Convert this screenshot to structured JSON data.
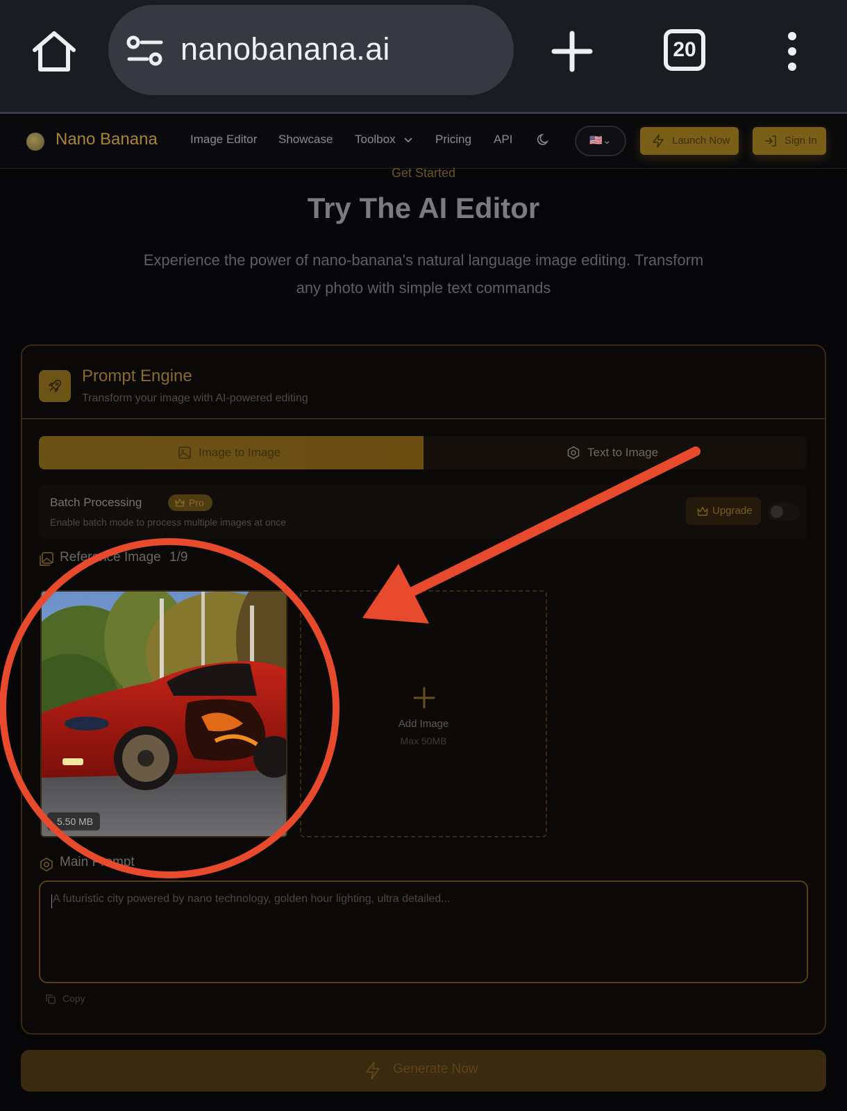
{
  "browser": {
    "url": "nanobanana.ai",
    "tab_count": "20"
  },
  "nav": {
    "brand": "Nano Banana",
    "links": [
      "Image Editor",
      "Showcase",
      "Toolbox",
      "Pricing",
      "API"
    ],
    "language_flag": "🇺🇸",
    "launch_label": "Launch Now",
    "signin_label": "Sign In"
  },
  "hero": {
    "eyebrow": "Get Started",
    "title": "Try The AI Editor",
    "subtitle": "Experience the power of nano-banana's natural language image editing. Transform any photo with simple text commands"
  },
  "card": {
    "title": "Prompt Engine",
    "subtitle": "Transform your image with AI-powered editing",
    "tabs": [
      {
        "label": "Image to Image",
        "active": true
      },
      {
        "label": "Text to Image",
        "active": false
      }
    ],
    "batch": {
      "title": "Batch Processing",
      "badge": "Pro",
      "description": "Enable batch mode to process multiple images at once",
      "upgrade_label": "Upgrade",
      "enabled": false
    },
    "reference": {
      "label": "Reference Image",
      "count": "1/9",
      "thumbnail_size": "5.50 MB",
      "add_label": "Add Image",
      "add_max": "Max 50MB"
    },
    "prompt": {
      "label": "Main Prompt",
      "placeholder": "A futuristic city powered by nano technology, golden hour lighting, ultra detailed...",
      "copy_label": "Copy"
    }
  },
  "generate_label": "Generate Now",
  "colors": {
    "accent_gold": "#7a5f18",
    "annotation_red": "#e84a2e",
    "background": "#060608"
  }
}
